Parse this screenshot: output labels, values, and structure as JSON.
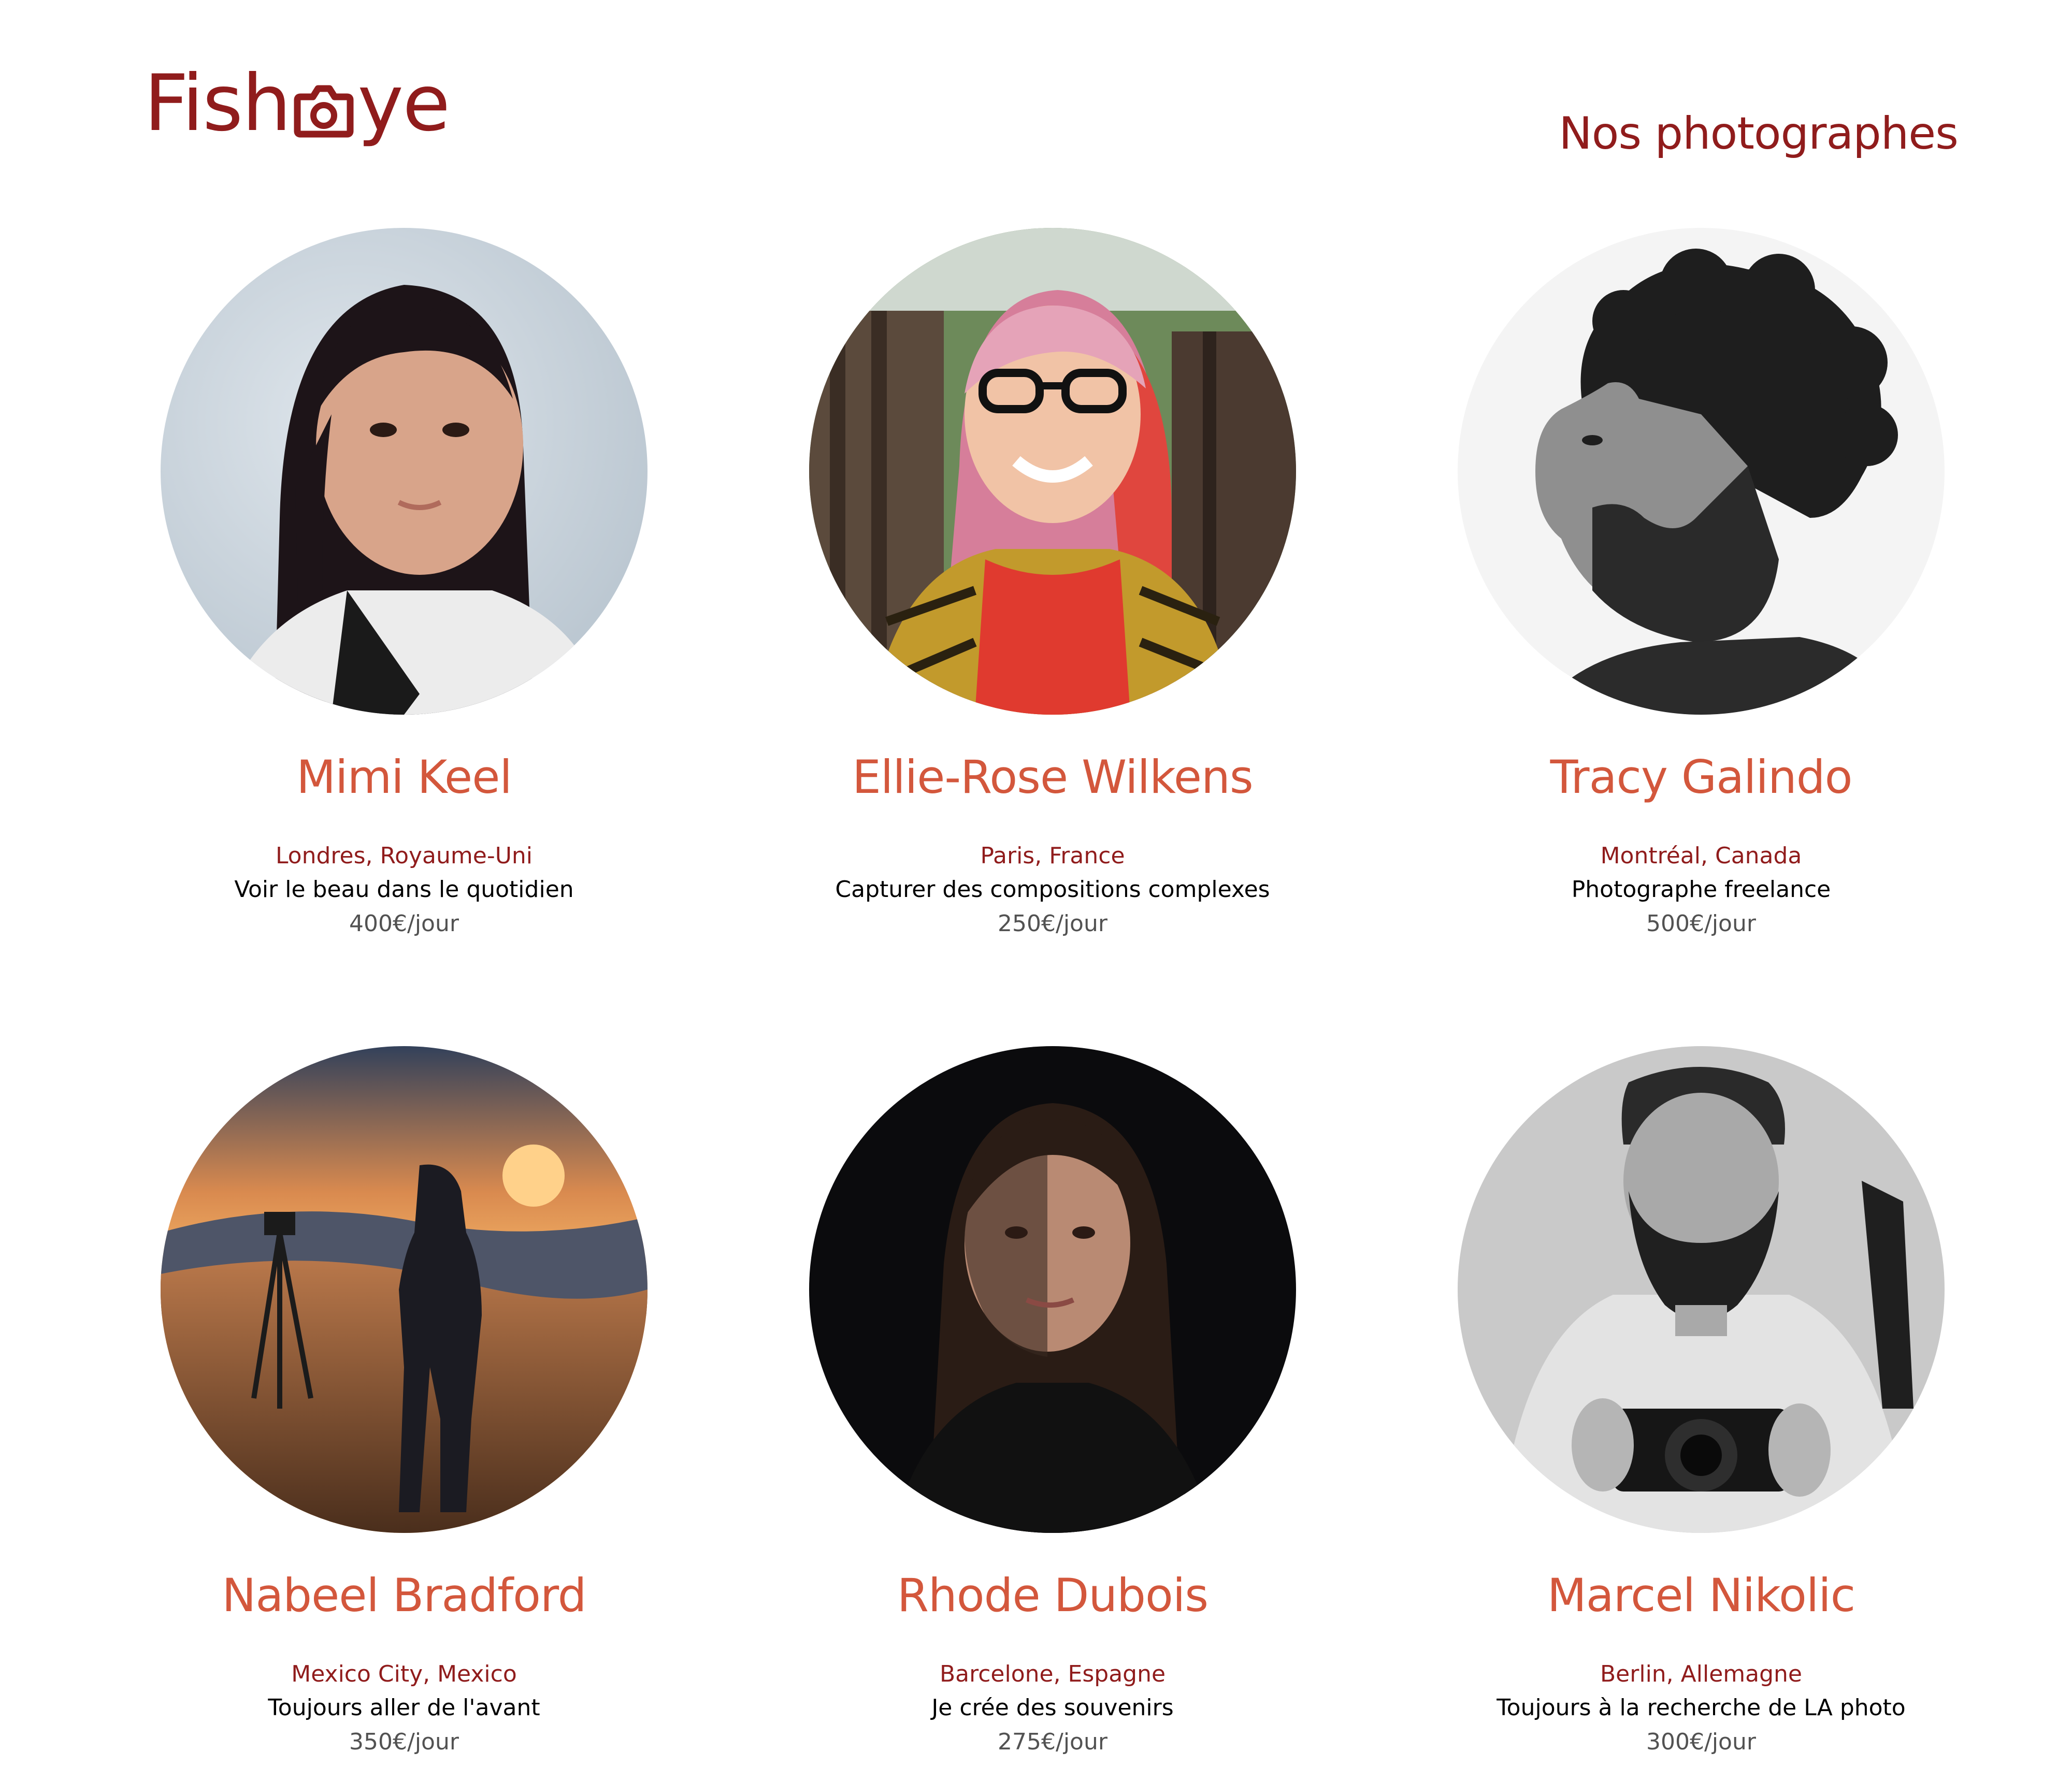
{
  "header": {
    "logo_text_left": "Fish",
    "logo_text_right": "ye",
    "logo_icon": "camera-icon",
    "title": "Nos photographes"
  },
  "colors": {
    "brand_dark_red": "#901c1c",
    "name_red": "#d3573c",
    "price_gray": "#525252"
  },
  "photographers": [
    {
      "name": "Mimi Keel",
      "location": "Londres, Royaume-Uni",
      "tagline": "Voir le beau dans le quotidien",
      "price": "400€/jour",
      "portrait_icon": "portrait-photo"
    },
    {
      "name": "Ellie-Rose Wilkens",
      "location": "Paris, France",
      "tagline": "Capturer des compositions complexes",
      "price": "250€/jour",
      "portrait_icon": "portrait-photo"
    },
    {
      "name": "Tracy Galindo",
      "location": "Montréal, Canada",
      "tagline": "Photographe freelance",
      "price": "500€/jour",
      "portrait_icon": "portrait-photo"
    },
    {
      "name": "Nabeel Bradford",
      "location": "Mexico City, Mexico",
      "tagline": "Toujours aller de l'avant",
      "price": "350€/jour",
      "portrait_icon": "portrait-photo"
    },
    {
      "name": "Rhode Dubois",
      "location": "Barcelone, Espagne",
      "tagline": "Je crée des souvenirs",
      "price": "275€/jour",
      "portrait_icon": "portrait-photo"
    },
    {
      "name": "Marcel Nikolic",
      "location": "Berlin, Allemagne",
      "tagline": "Toujours à la recherche de LA photo",
      "price": "300€/jour",
      "portrait_icon": "portrait-photo"
    }
  ]
}
